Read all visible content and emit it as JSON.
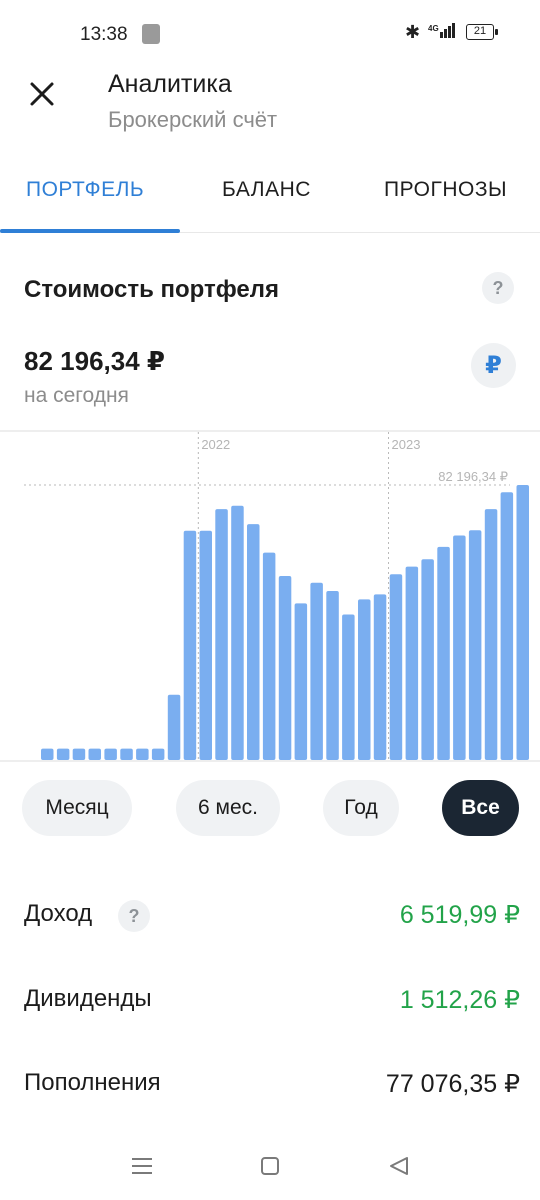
{
  "status_bar": {
    "time": "13:38",
    "network": "4G",
    "battery": "21"
  },
  "header": {
    "title": "Аналитика",
    "subtitle": "Брокерский счёт",
    "close_icon": "close-icon"
  },
  "tabs": [
    {
      "label": "ПОРТФЕЛЬ",
      "active": true
    },
    {
      "label": "БАЛАНС",
      "active": false
    },
    {
      "label": "ПРОГНОЗЫ",
      "active": false
    }
  ],
  "portfolio": {
    "title": "Стоимость портфеля",
    "help": "?",
    "value": "82 196,34 ₽",
    "caption": "на сегодня",
    "currency_symbol": "₽"
  },
  "periods": [
    {
      "label": "Месяц",
      "selected": false
    },
    {
      "label": "6 мес.",
      "selected": false
    },
    {
      "label": "Год",
      "selected": false
    },
    {
      "label": "Все",
      "selected": true
    }
  ],
  "stats": {
    "income_label": "Доход",
    "income_help": "?",
    "income_value": "6 519,99 ₽",
    "dividends_label": "Дивиденды",
    "dividends_value": "1 512,26 ₽",
    "deposits_label": "Пополнения",
    "deposits_value": "77 076,35 ₽"
  },
  "colors": {
    "accent": "#2f7fd6",
    "bar": "#7aaef0",
    "positive": "#22a349",
    "selected_period_bg": "#1b2633"
  },
  "chart_data": {
    "type": "bar",
    "year_markers": [
      {
        "label": "2022",
        "after_index": 9
      },
      {
        "label": "2023",
        "after_index": 21
      }
    ],
    "max_label": "82 196,34 ₽",
    "max_value": 82196.34,
    "values": [
      3400,
      3400,
      3400,
      3400,
      3400,
      3400,
      3400,
      3400,
      19500,
      68500,
      68500,
      75000,
      76000,
      70500,
      62000,
      55000,
      46800,
      53000,
      50500,
      43500,
      48000,
      49500,
      55500,
      57800,
      60000,
      63700,
      67100,
      68700,
      75000,
      80000,
      82196
    ]
  }
}
